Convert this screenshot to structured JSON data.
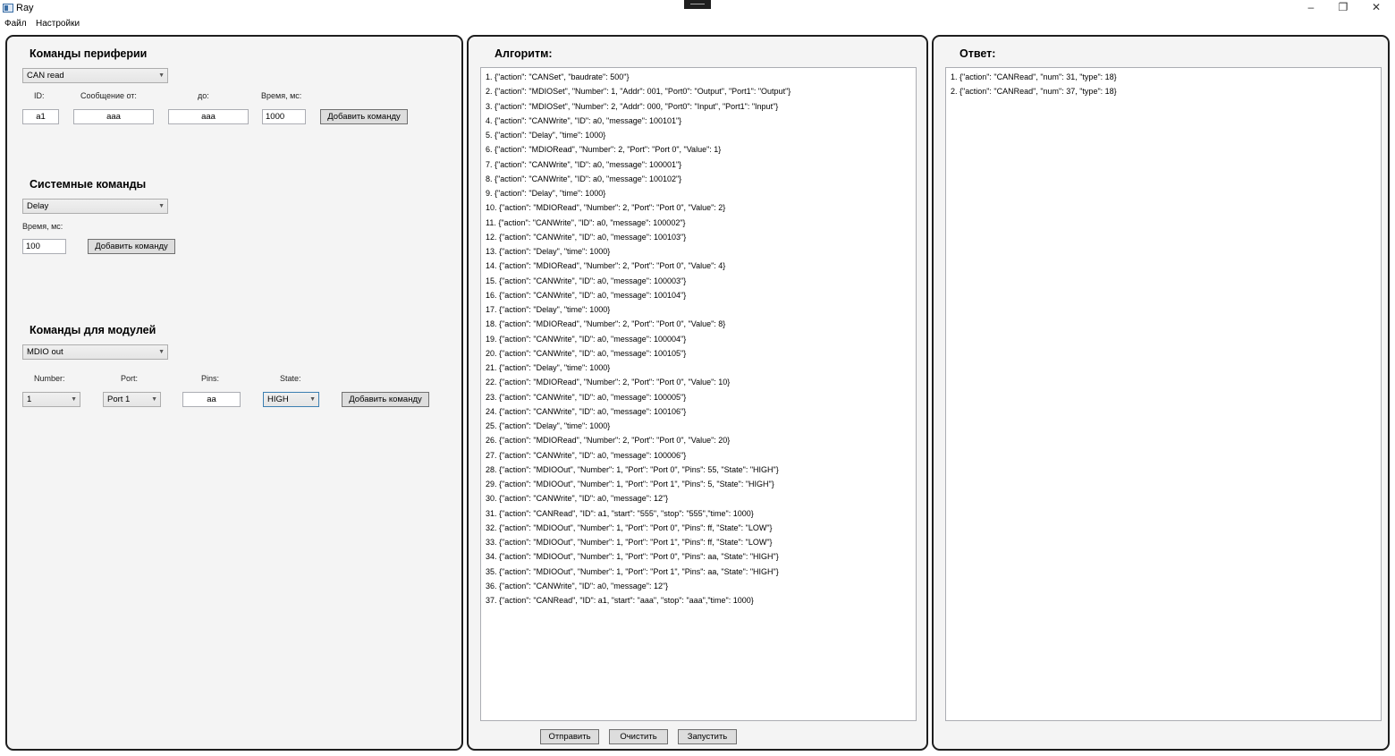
{
  "window": {
    "title": "Ray",
    "min": "–",
    "max": "❐",
    "close": "✕"
  },
  "menu": [
    "Файл",
    "Настройки"
  ],
  "left": {
    "peripheral": {
      "title": "Команды периферии",
      "select": "CAN read",
      "labels": [
        "ID:",
        "Сообщение от:",
        "до:",
        "Время, мс:"
      ],
      "values": [
        "a1",
        "aaa",
        "aaa",
        "1000"
      ],
      "button": "Добавить команду"
    },
    "system": {
      "title": "Системные команды",
      "select": "Delay",
      "time_label": "Время, мс:",
      "time_value": "100",
      "button": "Добавить команду"
    },
    "modules": {
      "title": "Команды для модулей",
      "select": "MDIO out",
      "labels": [
        "Number:",
        "Port:",
        "Pins:",
        "State:"
      ],
      "number": "1",
      "port": "Port 1",
      "pins": "aa",
      "state": "HIGH",
      "button": "Добавить команду"
    }
  },
  "algorithm": {
    "title": "Алгоритм:",
    "items": [
      "1. {\"action\": \"CANSet\", \"baudrate\": 500\"}",
      "2. {\"action\": \"MDIOSet\", \"Number\": 1, \"Addr\": 001, \"Port0\": \"Output\", \"Port1\": \"Output\"}",
      "3. {\"action\": \"MDIOSet\", \"Number\": 2, \"Addr\": 000, \"Port0\": \"Input\", \"Port1\": \"Input\"}",
      "4. {\"action\": \"CANWrite\", \"ID\": a0, \"message\": 100101\"}",
      "5. {\"action\": \"Delay\", \"time\": 1000}",
      "6. {\"action\": \"MDIORead\", \"Number\": 2, \"Port\":  \"Port 0\", \"Value\": 1}",
      "7. {\"action\": \"CANWrite\", \"ID\": a0, \"message\": 100001\"}",
      "8. {\"action\": \"CANWrite\", \"ID\": a0, \"message\": 100102\"}",
      "9. {\"action\": \"Delay\", \"time\": 1000}",
      "10. {\"action\": \"MDIORead\", \"Number\": 2, \"Port\":  \"Port 0\", \"Value\": 2}",
      "11. {\"action\": \"CANWrite\", \"ID\": a0, \"message\": 100002\"}",
      "12. {\"action\": \"CANWrite\", \"ID\": a0, \"message\": 100103\"}",
      "13. {\"action\": \"Delay\", \"time\": 1000}",
      "14. {\"action\": \"MDIORead\", \"Number\": 2, \"Port\":  \"Port 0\", \"Value\": 4}",
      "15. {\"action\": \"CANWrite\", \"ID\": a0, \"message\": 100003\"}",
      "16. {\"action\": \"CANWrite\", \"ID\": a0, \"message\": 100104\"}",
      "17. {\"action\": \"Delay\", \"time\": 1000}",
      "18. {\"action\": \"MDIORead\", \"Number\": 2, \"Port\":  \"Port 0\", \"Value\": 8}",
      "19. {\"action\": \"CANWrite\", \"ID\": a0, \"message\": 100004\"}",
      "20. {\"action\": \"CANWrite\", \"ID\": a0, \"message\": 100105\"}",
      "21. {\"action\": \"Delay\", \"time\": 1000}",
      "22. {\"action\": \"MDIORead\", \"Number\": 2, \"Port\":  \"Port 0\", \"Value\": 10}",
      "23. {\"action\": \"CANWrite\", \"ID\": a0, \"message\": 100005\"}",
      "24. {\"action\": \"CANWrite\", \"ID\": a0, \"message\": 100106\"}",
      "25. {\"action\": \"Delay\", \"time\": 1000}",
      "26. {\"action\": \"MDIORead\", \"Number\": 2, \"Port\":  \"Port 0\", \"Value\": 20}",
      "27. {\"action\": \"CANWrite\", \"ID\": a0, \"message\": 100006\"}",
      "28. {\"action\": \"MDIOOut\", \"Number\": 1, \"Port\":  \"Port 0\", \"Pins\": 55, \"State\": \"HIGH\"}",
      "29. {\"action\": \"MDIOOut\", \"Number\": 1, \"Port\":  \"Port 1\", \"Pins\": 5, \"State\": \"HIGH\"}",
      "30. {\"action\": \"CANWrite\", \"ID\": a0, \"message\": 12\"}",
      "31. {\"action\": \"CANRead\", \"ID\": a1, \"start\": \"555\", \"stop\": \"555\",\"time\": 1000}",
      "32. {\"action\": \"MDIOOut\", \"Number\": 1, \"Port\":  \"Port 0\", \"Pins\": ff, \"State\": \"LOW\"}",
      "33. {\"action\": \"MDIOOut\", \"Number\": 1, \"Port\":  \"Port 1\", \"Pins\": ff, \"State\": \"LOW\"}",
      "34. {\"action\": \"MDIOOut\", \"Number\": 1, \"Port\":  \"Port 0\", \"Pins\": aa, \"State\": \"HIGH\"}",
      "35. {\"action\": \"MDIOOut\", \"Number\": 1, \"Port\":  \"Port 1\", \"Pins\": aa, \"State\": \"HIGH\"}",
      "36. {\"action\": \"CANWrite\", \"ID\": a0, \"message\": 12\"}",
      "37. {\"action\": \"CANRead\", \"ID\": a1, \"start\": \"aaa\", \"stop\": \"aaa\",\"time\": 1000}"
    ],
    "buttons": [
      "Отправить",
      "Очистить",
      "Запустить"
    ]
  },
  "response": {
    "title": "Ответ:",
    "items": [
      "1. {\"action\": \"CANRead\", \"num\": 31, \"type\": 18}",
      "2. {\"action\": \"CANRead\", \"num\": 37, \"type\": 18}"
    ]
  }
}
